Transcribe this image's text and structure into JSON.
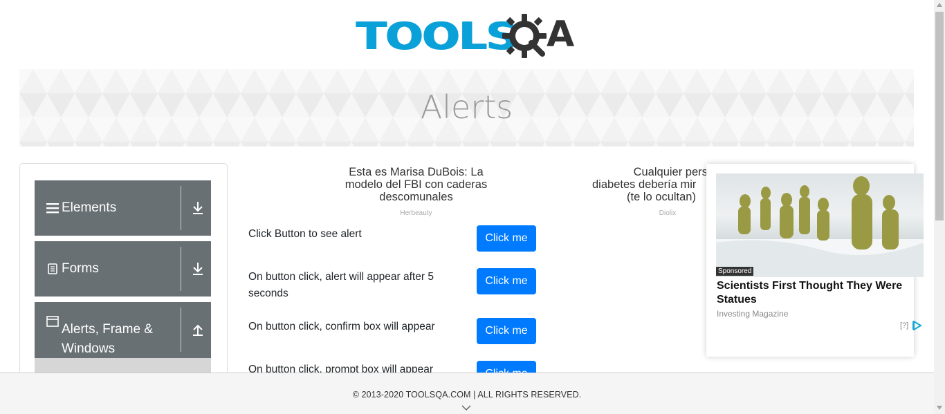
{
  "header": {
    "logo_text": "TOOLSQA",
    "logo_tools": "TOOLS",
    "logo_a": "A"
  },
  "banner": {
    "title": "Alerts"
  },
  "sidebar": {
    "groups": [
      {
        "label": "Elements",
        "icon": "hamburger-icon",
        "arrow": "download-arrow-icon"
      },
      {
        "label": "Forms",
        "icon": "document-icon",
        "arrow": "download-arrow-icon"
      },
      {
        "label": "Alerts, Frame & Windows",
        "icon": "window-icon",
        "arrow": "upload-arrow-icon"
      }
    ]
  },
  "ads": {
    "left": {
      "text": "Esta es Marisa DuBois: La modelo del FBI con caderas descomunales",
      "source": "Herbeauty"
    },
    "middle": {
      "line1": "Cualquier persona",
      "line2": "diabetes debería mir",
      "line3": "(te lo ocultan)",
      "source": "Diolix"
    }
  },
  "alerts": [
    {
      "label": "Click Button to see alert",
      "button": "Click me"
    },
    {
      "label": "On button click, alert will appear after 5 seconds",
      "button": "Click me"
    },
    {
      "label": "On button click, confirm box will appear",
      "button": "Click me"
    },
    {
      "label": "On button click, prompt box will appear",
      "button": "Click me"
    }
  ],
  "sponsored": {
    "tag": "Sponsored",
    "title": "Scientists First Thought They Were Statues",
    "source": "Investing Magazine",
    "help": "[?]"
  },
  "footer": {
    "text": "© 2013-2020 TOOLSQA.COM | ALL RIGHTS RESERVED."
  },
  "colors": {
    "primary_button": "#007bff",
    "sidebar_group": "#687074",
    "logo_blue": "#0aa0d8",
    "logo_dark": "#333333"
  }
}
